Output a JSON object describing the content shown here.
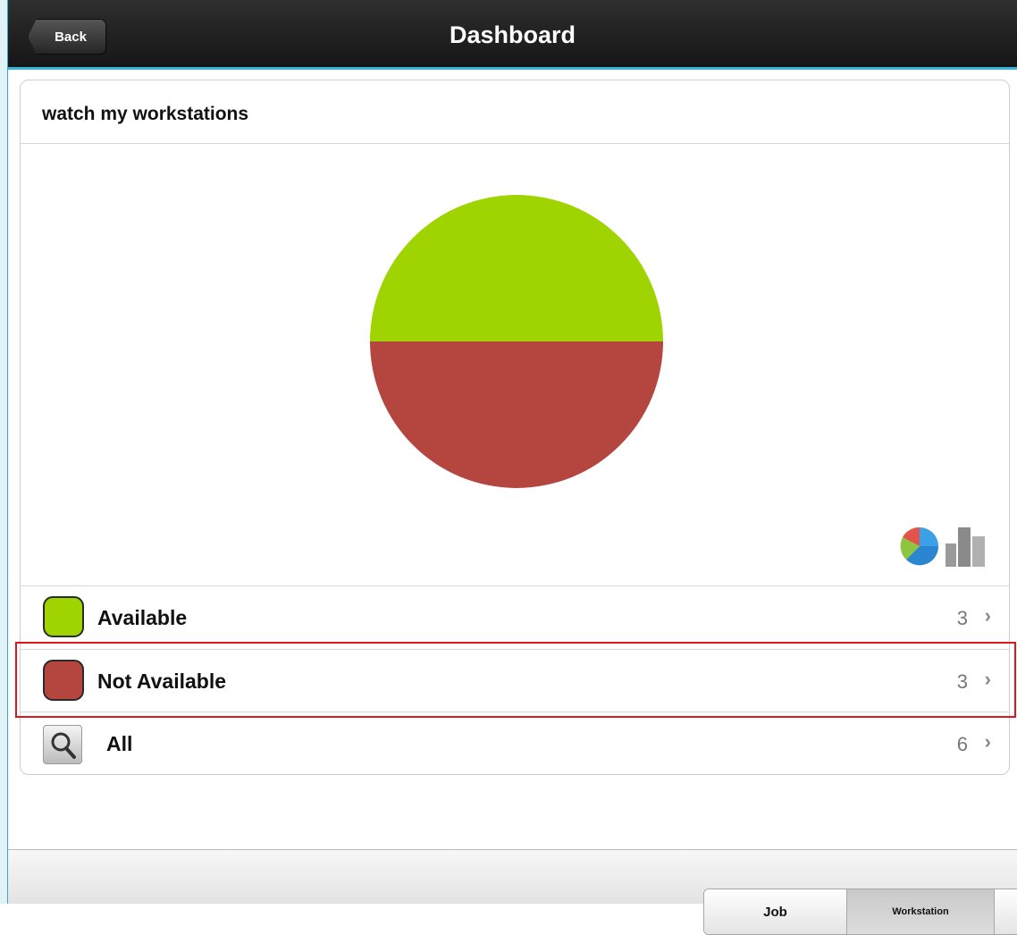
{
  "header": {
    "back_label": "Back",
    "title": "Dashboard"
  },
  "panel": {
    "title": "watch my workstations",
    "chart_toggles": [
      "pie-chart-icon",
      "bar-chart-icon"
    ]
  },
  "chart_data": {
    "type": "pie",
    "categories": [
      "Available",
      "Not Available"
    ],
    "values": [
      3,
      3
    ],
    "colors": [
      "#9fd400",
      "#b5463f"
    ]
  },
  "rows": [
    {
      "label": "Available",
      "count": "3",
      "color": "#9fd400",
      "icon": "green-swatch-icon"
    },
    {
      "label": "Not Available",
      "count": "3",
      "color": "#b5463f",
      "icon": "red-swatch-icon"
    },
    {
      "label": "All",
      "count": "6",
      "icon": "search-icon"
    }
  ],
  "chevron": "›",
  "tabs": {
    "job": "Job",
    "workstation": "Workstation",
    "selected": "Workstation"
  },
  "colors": {
    "header_accent": "#37b4d8",
    "highlight": "#e0161f"
  }
}
